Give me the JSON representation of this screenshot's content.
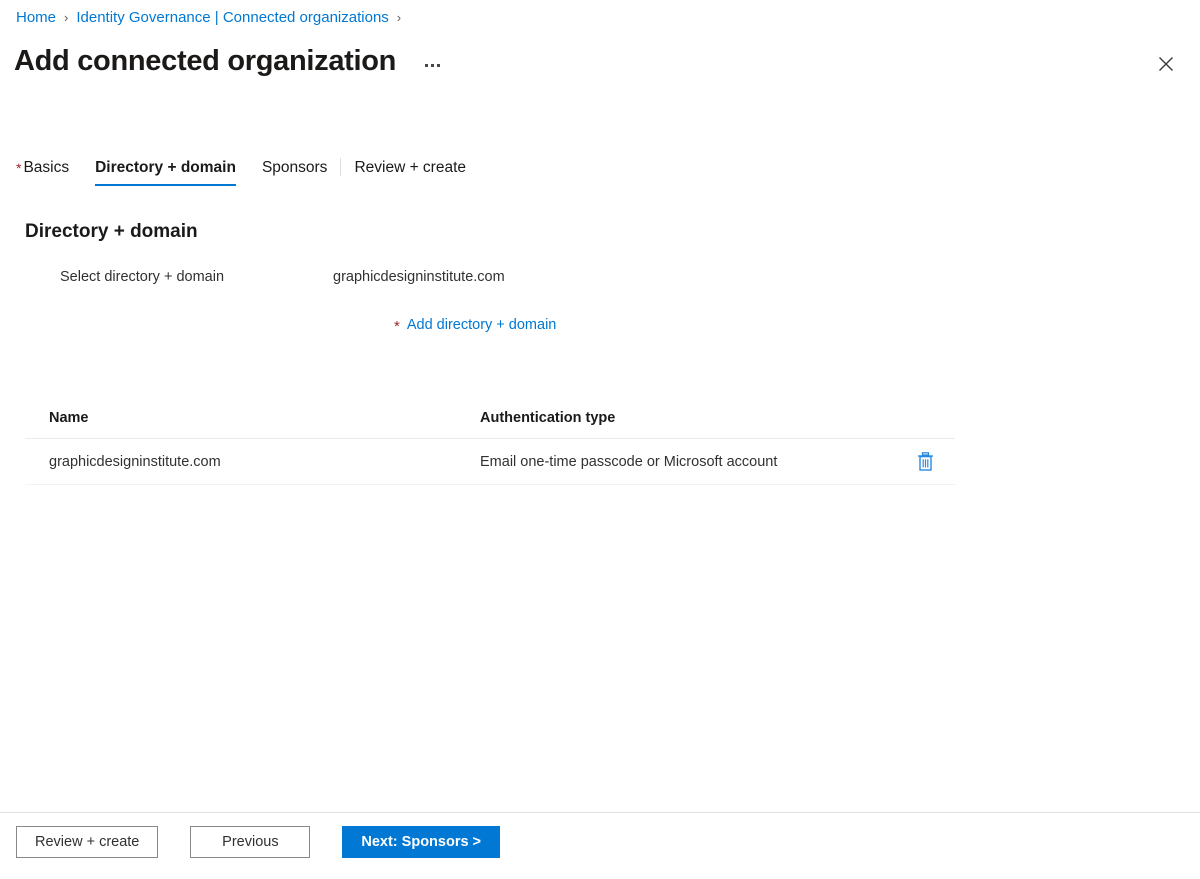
{
  "breadcrumb": {
    "items": [
      {
        "label": "Home"
      },
      {
        "label": "Identity Governance | Connected organizations"
      }
    ],
    "separator": "›"
  },
  "header": {
    "title": "Add connected organization",
    "more_menu_icon": "ellipsis-icon",
    "close_icon": "close-icon"
  },
  "tabs": [
    {
      "label": "Basics",
      "required": true,
      "active": false
    },
    {
      "label": "Directory + domain",
      "required": false,
      "active": true
    },
    {
      "label": "Sponsors",
      "required": false,
      "active": false
    },
    {
      "label": "Review + create",
      "required": false,
      "active": false
    }
  ],
  "section": {
    "heading": "Directory + domain",
    "field_label": "Select directory + domain",
    "field_value": "graphicdesigninstitute.com",
    "add_link_label": "Add directory + domain",
    "add_link_required_marker": "*"
  },
  "table": {
    "columns": [
      "Name",
      "Authentication type"
    ],
    "rows": [
      {
        "name": "graphicdesigninstitute.com",
        "auth_type": "Email one-time passcode or Microsoft account",
        "delete_icon": "trash-icon"
      }
    ]
  },
  "footer": {
    "review_create_label": "Review + create",
    "previous_label": "Previous",
    "next_label": "Next: Sponsors >"
  },
  "colors": {
    "accent": "#0078d4",
    "required_red": "#a4262c",
    "text": "#323130",
    "heading": "#1b1a19",
    "border": "#e1dfdd"
  }
}
